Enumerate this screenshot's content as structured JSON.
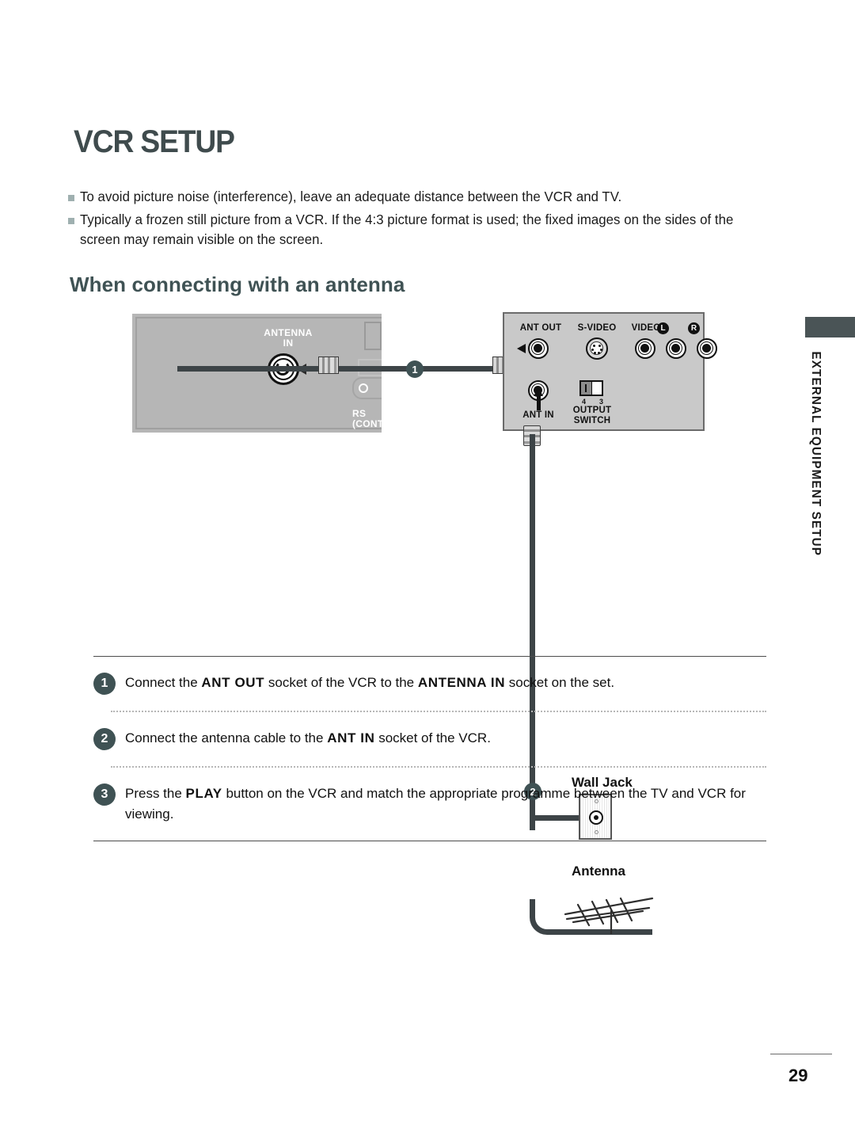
{
  "page": {
    "title": "VCR SETUP",
    "number": "29",
    "side_tab_text": "EXTERNAL EQUIPMENT SETUP"
  },
  "intro_bullets": [
    "To avoid picture noise (interference), leave an adequate distance between the VCR and TV.",
    "Typically a frozen still picture from a VCR. If the 4:3 picture format is used; the fixed images on the sides of the screen may remain visible on the screen."
  ],
  "section": {
    "heading": "When connecting with an antenna"
  },
  "diagram": {
    "tv_panel": {
      "antenna_in_label": "ANTENNA\nIN",
      "antenna_in_line1": "ANTENNA",
      "antenna_in_line2": "IN",
      "rs_label_line1": "RS",
      "rs_label_line2": "(CONTRO"
    },
    "vcr_panel": {
      "ant_out": "ANT OUT",
      "s_video": "S-VIDEO",
      "video": "VIDEO",
      "audio_left": "L",
      "audio_right": "R",
      "ant_in": "ANT IN",
      "output_switch_line1": "OUTPUT",
      "output_switch_line2": "SWITCH",
      "switch_pos_left": "4",
      "switch_pos_right": "3"
    },
    "wall_jack_label": "Wall Jack",
    "antenna_label": "Antenna",
    "cable_badges": [
      "1",
      "2"
    ]
  },
  "steps": [
    {
      "number": "1",
      "parts": [
        {
          "t": "Connect the ",
          "b": false
        },
        {
          "t": "ANT  OUT",
          "b": true
        },
        {
          "t": " socket of the VCR to the ",
          "b": false
        },
        {
          "t": "ANTENNA IN",
          "b": true
        },
        {
          "t": " socket on the set.",
          "b": false
        }
      ]
    },
    {
      "number": "2",
      "parts": [
        {
          "t": "Connect the antenna cable to the ",
          "b": false
        },
        {
          "t": "ANT IN",
          "b": true
        },
        {
          "t": " socket of the VCR.",
          "b": false
        }
      ]
    },
    {
      "number": "3",
      "parts": [
        {
          "t": "Press the ",
          "b": false
        },
        {
          "t": "PLAY",
          "b": true
        },
        {
          "t": " button on the VCR and match the appropriate programme between the TV and VCR for viewing.",
          "b": false
        }
      ]
    }
  ],
  "colors": {
    "heading": "#3f5254",
    "badge": "#3f5254",
    "tab": "#4a5456",
    "cable": "#3d4447",
    "tv_panel_bg": "#b6b6b6",
    "vcr_panel_bg": "#c9c9c9",
    "bullet": "#9fb0b0"
  }
}
